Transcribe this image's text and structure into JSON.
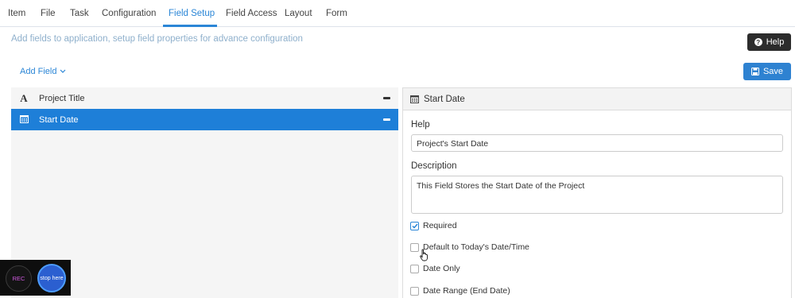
{
  "tabs": [
    {
      "label": "Item"
    },
    {
      "label": "File"
    },
    {
      "label": "Task"
    },
    {
      "label": "Configuration"
    },
    {
      "label": "Field Setup",
      "active": true
    },
    {
      "label": "Field Access"
    },
    {
      "label": "Layout"
    },
    {
      "label": "Form"
    }
  ],
  "subtitle": "Add fields to application, setup field properties for advance configuration",
  "buttons": {
    "help": "Help",
    "save": "Save",
    "add_field": "Add Field"
  },
  "fields": [
    {
      "label": "Project Title",
      "icon": "text-type-icon"
    },
    {
      "label": "Start Date",
      "icon": "calendar-icon",
      "selected": true
    }
  ],
  "panel": {
    "title": "Start Date",
    "help_label": "Help",
    "help_value": "Project's Start Date",
    "description_label": "Description",
    "description_value": "This Field Stores the Start Date of the Project",
    "checkboxes": [
      {
        "label": "Required",
        "checked": true
      },
      {
        "label": "Default to Today's Date/Time",
        "checked": false
      },
      {
        "label": "Date Only",
        "checked": false
      },
      {
        "label": "Date Range (End Date)",
        "checked": false
      }
    ]
  },
  "recorder": {
    "rec": "REC",
    "stop": "stop here"
  },
  "colors": {
    "accent": "#2b86d6",
    "selected_row": "#1e7fd8",
    "save_button": "#2e82d1",
    "help_button": "#2c2c2c"
  }
}
